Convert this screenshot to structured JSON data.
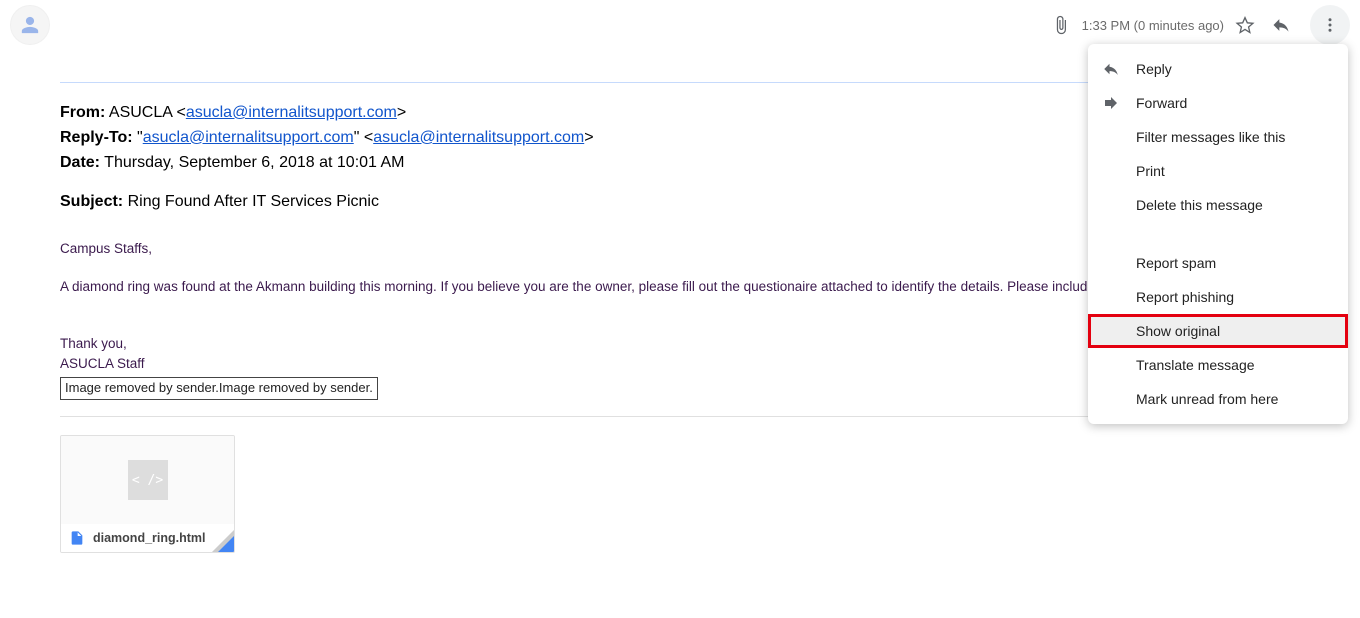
{
  "header": {
    "timestamp": "1:33 PM (0 minutes ago)"
  },
  "fields": {
    "from_label": "From:",
    "from_name": "ASUCLA",
    "from_email": "asucla@internalitsupport.com",
    "replyto_label": "Reply-To:",
    "replyto_name": "asucla@internalitsupport.com",
    "replyto_email": "asucla@internalitsupport.com",
    "date_label": "Date:",
    "date_value": "Thursday, September 6, 2018 at 10:01 AM",
    "subject_label": "Subject:",
    "subject_value": "Ring Found After IT Services Picnic"
  },
  "body": {
    "greeting": "Campus Staffs,",
    "para1": "A diamond ring was found at the Akmann building this morning.  If you believe you are the owner, please fill out the questionaire attached to identify the details.  Please include the as soon as possible.",
    "thanks": "Thank you,",
    "sig": "ASUCLA Staff",
    "removed": "Image removed by sender.Image removed by sender."
  },
  "attachment": {
    "name": "diamond_ring.html"
  },
  "menu": {
    "reply": "Reply",
    "forward": "Forward",
    "filter": "Filter messages like this",
    "print": "Print",
    "delete": "Delete this message",
    "spam": "Report spam",
    "phishing": "Report phishing",
    "show_original": "Show original",
    "translate": "Translate message",
    "mark_unread": "Mark unread from here"
  }
}
